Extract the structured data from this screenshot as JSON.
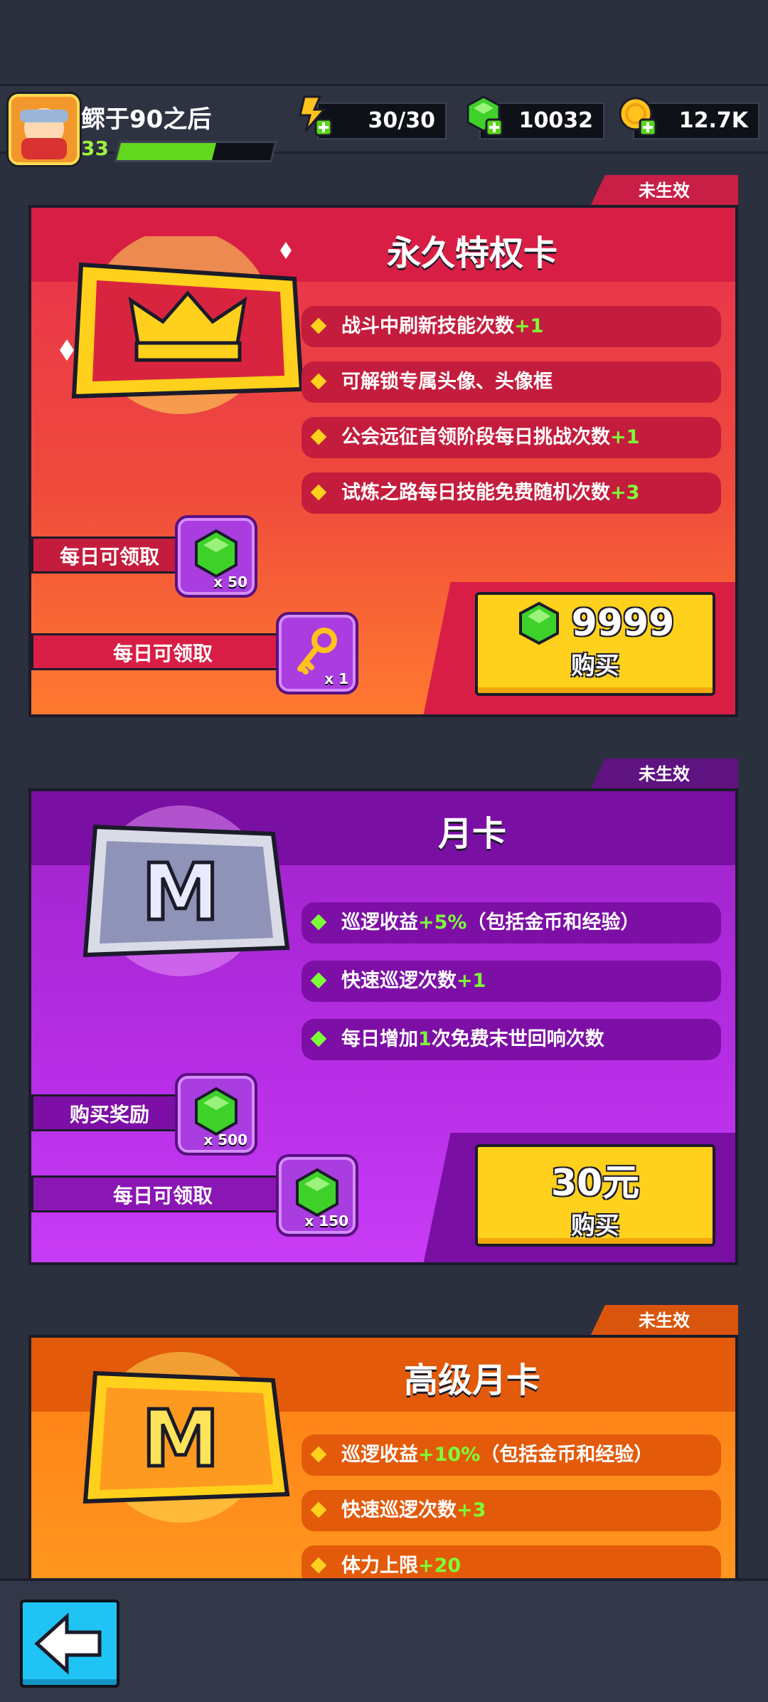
{
  "player": {
    "name": "鳏于90之后",
    "level": "33",
    "xp_fraction": 0.62
  },
  "resources": [
    {
      "name": "energy",
      "icon": "lightning-plus-icon",
      "value": "30/30"
    },
    {
      "name": "gems",
      "icon": "green-gem-plus-icon",
      "value": "10032"
    },
    {
      "name": "gold",
      "icon": "gold-coin-plus-icon",
      "value": "12.7K"
    }
  ],
  "cards": [
    {
      "status": "未生效",
      "title": "永久特权卡",
      "perks": [
        {
          "text": "战斗中刷新技能次数",
          "bonus": "+1"
        },
        {
          "text": "可解锁专属头像、头像框",
          "bonus": ""
        },
        {
          "text": "公会远征首领阶段每日挑战次数",
          "bonus": "+1"
        },
        {
          "text": "试炼之路每日技能免费随机次数",
          "bonus": "+3"
        }
      ],
      "rewards": [
        {
          "label": "每日可领取",
          "icon": "green-gem-icon",
          "qty": "x 50"
        },
        {
          "label": "每日可领取",
          "icon": "gold-key-icon",
          "qty": "x 1"
        }
      ],
      "price": "9999",
      "buy_label": "购买"
    },
    {
      "status": "未生效",
      "title": "月卡",
      "perks": [
        {
          "text": "巡逻收益",
          "bonus": "+5%",
          "suffix": "（包括金币和经验）"
        },
        {
          "text": "快速巡逻次数",
          "bonus": "+1",
          "suffix": ""
        },
        {
          "text": "每日增加",
          "bonus": "1",
          "suffix": "次免费末世回响次数"
        }
      ],
      "rewards": [
        {
          "label": "购买奖励",
          "icon": "green-gem-icon",
          "qty": "x 500"
        },
        {
          "label": "每日可领取",
          "icon": "green-gem-icon",
          "qty": "x 150"
        }
      ],
      "price": "30元",
      "buy_label": "购买"
    },
    {
      "status": "未生效",
      "title": "高级月卡",
      "perks": [
        {
          "text": "巡逻收益",
          "bonus": "+10%",
          "suffix": "（包括金币和经验）"
        },
        {
          "text": "快速巡逻次数",
          "bonus": "+3",
          "suffix": ""
        },
        {
          "text": "体力上限",
          "bonus": "+20",
          "suffix": ""
        }
      ]
    }
  ],
  "colors": {
    "red_card": "#e8314f",
    "purple_card": "#b72ee6",
    "orange_card": "#ff8a18",
    "buy_yellow": "#ffd11c",
    "bonus_green": "#7dff37"
  }
}
